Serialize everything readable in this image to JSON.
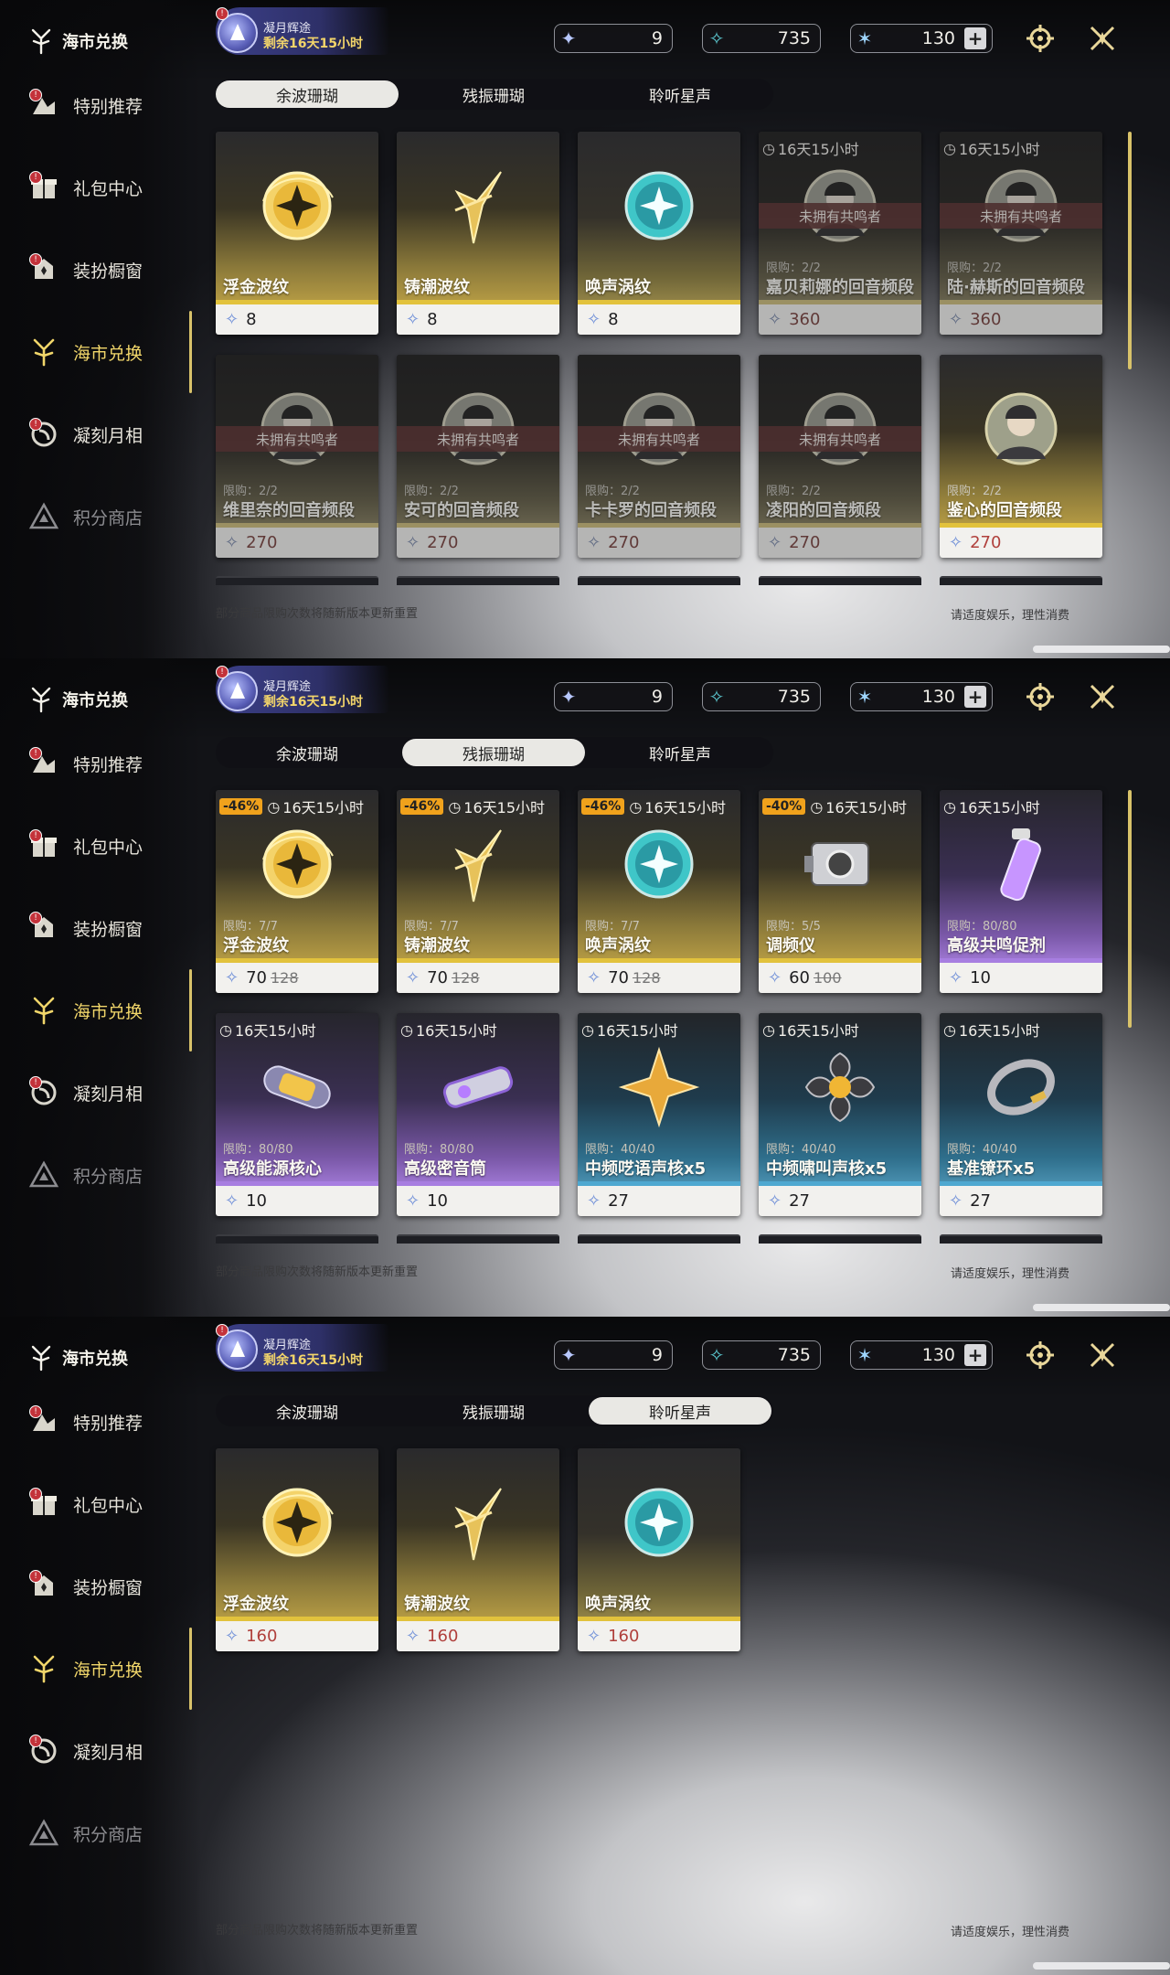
{
  "app": {
    "brand": "海市兑换",
    "nav": [
      "特别推荐",
      "礼包中心",
      "装扮橱窗",
      "海市兑换",
      "凝刻月相",
      "积分商店"
    ],
    "event": {
      "title": "凝月辉途",
      "remaining": "剩余16天15小时"
    },
    "currencies": [
      {
        "icon": "lunite-icon",
        "value": "9"
      },
      {
        "icon": "coral-icon",
        "value": "735"
      },
      {
        "icon": "star-icon",
        "value": "130",
        "plus": "+"
      }
    ],
    "tabs": [
      "余波珊瑚",
      "残振珊瑚",
      "聆听星声"
    ],
    "footer_left": "部分商品限购次数将随新版本更新重置",
    "footer_right": "请适度娱乐，理性消费",
    "colors": {
      "accent": "#f1d66a",
      "owned_banner": "#8c3434",
      "discount": "#f0a21c"
    }
  },
  "panels": [
    {
      "active_tab": 0,
      "items": [
        {
          "name": "浮金波纹",
          "price": "8",
          "style": "gold",
          "icon": "golden-orb-icon"
        },
        {
          "name": "铸潮波纹",
          "price": "8",
          "style": "gold",
          "icon": "golden-blade-icon"
        },
        {
          "name": "唤声涡纹",
          "price": "8",
          "style": "dark",
          "icon": "teal-orb-icon"
        },
        {
          "name": "嘉贝莉娜的回音频段",
          "price": "360",
          "red": true,
          "style": "dark",
          "timer": "16天15小时",
          "owned": "未拥有共鸣者",
          "limit": "限购：2/2",
          "fade": true,
          "icon": "portrait-icon"
        },
        {
          "name": "陆·赫斯的回音频段",
          "price": "360",
          "red": true,
          "style": "dark",
          "timer": "16天15小时",
          "owned": "未拥有共鸣者",
          "limit": "限购：2/2",
          "fade": true,
          "icon": "portrait-icon"
        },
        {
          "name": "维里奈的回音频段",
          "price": "270",
          "red": true,
          "style": "dark",
          "owned": "未拥有共鸣者",
          "limit": "限购：2/2",
          "fade": true,
          "icon": "portrait-icon"
        },
        {
          "name": "安可的回音频段",
          "price": "270",
          "red": true,
          "style": "dark",
          "owned": "未拥有共鸣者",
          "limit": "限购：2/2",
          "fade": true,
          "icon": "portrait-icon"
        },
        {
          "name": "卡卡罗的回音频段",
          "price": "270",
          "red": true,
          "style": "dark",
          "owned": "未拥有共鸣者",
          "limit": "限购：2/2",
          "fade": true,
          "icon": "portrait-icon"
        },
        {
          "name": "凌阳的回音频段",
          "price": "270",
          "red": true,
          "style": "dark",
          "owned": "未拥有共鸣者",
          "limit": "限购：2/2",
          "fade": true,
          "icon": "portrait-icon"
        },
        {
          "name": "鉴心的回音频段",
          "price": "270",
          "red": true,
          "style": "gold",
          "limit": "限购：2/2",
          "icon": "portrait-icon"
        }
      ]
    },
    {
      "active_tab": 1,
      "items": [
        {
          "name": "浮金波纹",
          "price": "70",
          "old": "128",
          "style": "gold",
          "timer": "16天15小时",
          "discount": "-46%",
          "limit": "限购：7/7",
          "icon": "golden-orb-icon"
        },
        {
          "name": "铸潮波纹",
          "price": "70",
          "old": "128",
          "style": "gold",
          "timer": "16天15小时",
          "discount": "-46%",
          "limit": "限购：7/7",
          "icon": "golden-blade-icon"
        },
        {
          "name": "唤声涡纹",
          "price": "70",
          "old": "128",
          "style": "gold",
          "timer": "16天15小时",
          "discount": "-46%",
          "limit": "限购：7/7",
          "icon": "teal-orb-icon"
        },
        {
          "name": "调频仪",
          "price": "60",
          "old": "100",
          "style": "gold",
          "timer": "16天15小时",
          "discount": "-40%",
          "limit": "限购：5/5",
          "icon": "device-icon"
        },
        {
          "name": "高级共鸣促剂",
          "price": "10",
          "style": "purple",
          "timer": "16天15小时",
          "limit": "限购：80/80",
          "icon": "vial-icon"
        },
        {
          "name": "高级能源核心",
          "price": "10",
          "style": "purple",
          "timer": "16天15小时",
          "limit": "限购：80/80",
          "icon": "capsule-icon"
        },
        {
          "name": "高级密音筒",
          "price": "10",
          "style": "purple",
          "timer": "16天15小时",
          "limit": "限购：80/80",
          "icon": "tube-icon"
        },
        {
          "name": "中频呓语声核x5",
          "price": "27",
          "style": "blue",
          "timer": "16天15小时",
          "limit": "限购：40/40",
          "icon": "star-core-icon"
        },
        {
          "name": "中频啸叫声核x5",
          "price": "27",
          "style": "blue",
          "timer": "16天15小时",
          "limit": "限购：40/40",
          "icon": "flower-core-icon"
        },
        {
          "name": "基准镣环x5",
          "price": "27",
          "style": "blue",
          "timer": "16天15小时",
          "limit": "限购：40/40",
          "icon": "ring-icon"
        }
      ]
    },
    {
      "active_tab": 2,
      "items": [
        {
          "name": "浮金波纹",
          "price": "160",
          "red": true,
          "style": "gold",
          "icon": "golden-orb-icon"
        },
        {
          "name": "铸潮波纹",
          "price": "160",
          "red": true,
          "style": "gold",
          "icon": "golden-blade-icon"
        },
        {
          "name": "唤声涡纹",
          "price": "160",
          "red": true,
          "style": "dark",
          "icon": "teal-orb-icon"
        }
      ]
    }
  ]
}
